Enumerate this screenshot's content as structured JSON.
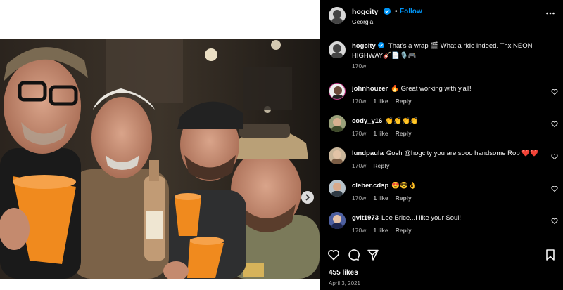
{
  "header": {
    "username": "hogcity",
    "separator": "•",
    "follow_label": "Follow",
    "location": "Georgia"
  },
  "caption": {
    "username": "hogcity",
    "text": "That's a wrap 🎬 What a ride indeed. Thx NEON HIGHWAY🎸📄🎙️🎮",
    "age": "170w"
  },
  "comments": [
    {
      "username": "johnhouzer",
      "text": "🔥 Great working with y'all!",
      "age": "170w",
      "likes": "1 like",
      "reply_label": "Reply"
    },
    {
      "username": "cody_y16",
      "text": "👏👏👏👏",
      "age": "170w",
      "likes": "1 like",
      "reply_label": "Reply"
    },
    {
      "username": "lundpaula",
      "text": "Gosh @hogcity you are sooo handsome Rob ❤️❤️",
      "age": "170w",
      "likes": "",
      "reply_label": "Reply"
    },
    {
      "username": "cleber.cdsp",
      "text": "😍😎👌",
      "age": "170w",
      "likes": "1 like",
      "reply_label": "Reply"
    },
    {
      "username": "gvit1973",
      "text": "Lee Brice...I like your Soul!",
      "age": "170w",
      "likes": "1 like",
      "reply_label": "Reply"
    }
  ],
  "footer": {
    "likes": "455 likes",
    "date": "April 3, 2021"
  },
  "icons": {
    "like": "heart-icon",
    "comment": "comment-icon",
    "share": "send-icon",
    "save": "bookmark-icon",
    "more": "more-icon",
    "verified": "verified-badge-icon"
  },
  "colors": {
    "background": "#000000",
    "accent": "#0095f6",
    "muted": "#a8a8a8",
    "cup": "#f08a1e"
  }
}
